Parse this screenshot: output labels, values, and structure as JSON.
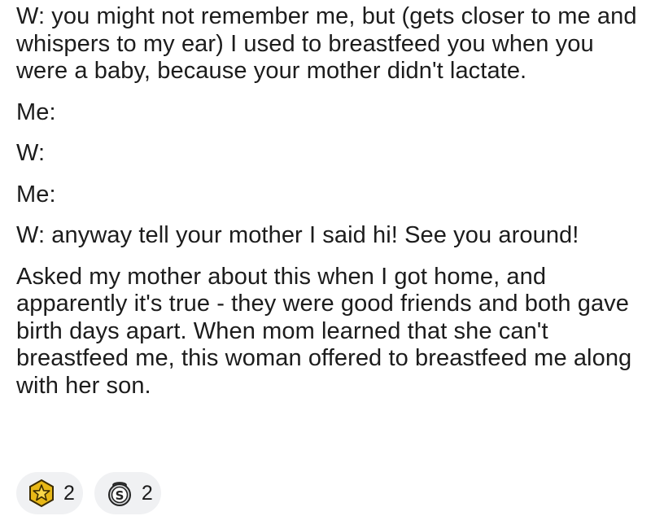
{
  "post": {
    "paragraphs": [
      "W: you might not remember me, but (gets closer to me and whispers to my ear) I used to breastfeed you when you were a baby, because your mother didn't lactate.",
      "Me:",
      "W:",
      "Me:",
      "W: anyway tell your mother I said hi! See you around!",
      "Asked my mother about this when I got home, and apparently it's true - they were good friends and both gave birth days apart. When mom learned that she can't breastfeed me, this woman offered to breastfeed me along with her son."
    ]
  },
  "awards": [
    {
      "icon": "star-award-icon",
      "count": "2",
      "color": "#e8b817"
    },
    {
      "icon": "silver-award-icon",
      "count": "2",
      "color": "#b9bcbf"
    }
  ]
}
